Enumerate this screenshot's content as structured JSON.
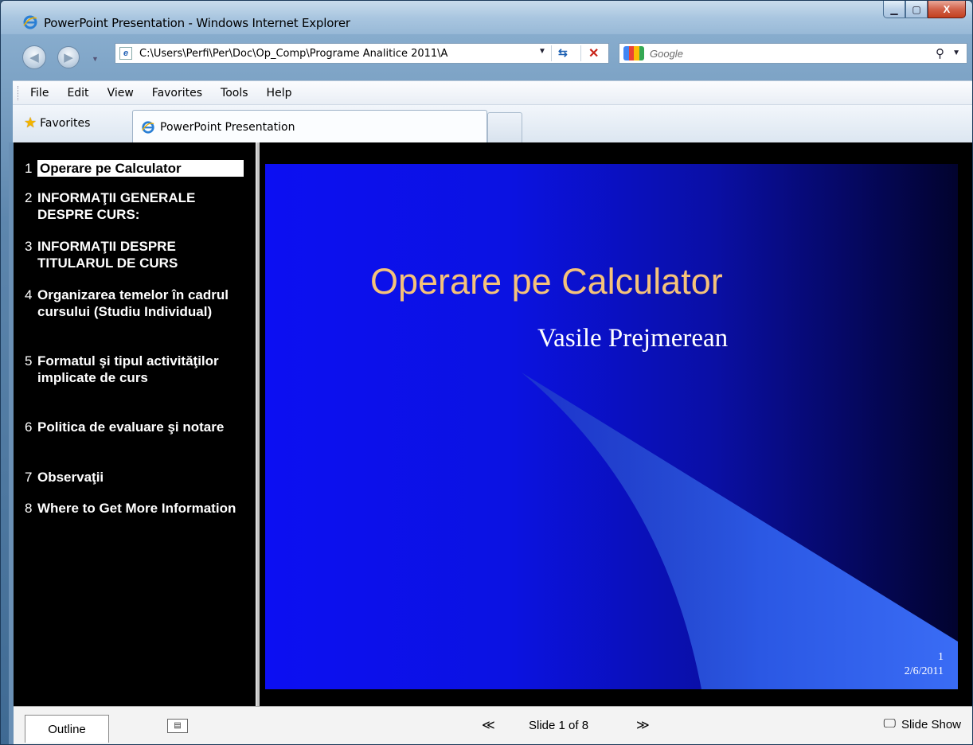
{
  "window": {
    "title": "PowerPoint Presentation - Windows Internet Explorer",
    "caption_minimize": "▁",
    "caption_maximize": "▢",
    "caption_close": "X"
  },
  "nav": {
    "back_icon": "◀",
    "forward_icon": "▶",
    "address": "C:\\Users\\Perfi\\Per\\Doc\\Op_Comp\\Programe Analitice 2011\\A",
    "search_placeholder": "Google",
    "refresh_icon": "⇆",
    "stop_icon": "✕",
    "search_icon": "⚲",
    "dropdown_icon": "▼"
  },
  "menu": [
    "File",
    "Edit",
    "View",
    "Favorites",
    "Tools",
    "Help"
  ],
  "tabs": {
    "favorites_label": "Favorites",
    "active_tab": "PowerPoint Presentation"
  },
  "outline": {
    "items": [
      {
        "num": "1",
        "text": "Operare pe Calculator",
        "selected": true
      },
      {
        "num": "2",
        "text": "INFORMAŢII GENERALE DESPRE CURS:"
      },
      {
        "num": "3",
        "text": "INFORMAŢII DESPRE TITULARUL DE CURS"
      },
      {
        "num": "4",
        "text": "Organizarea temelor în cadrul cursului  (Studiu Individual)"
      },
      {
        "num": "5",
        "text": "Formatul şi tipul activităţilor implicate de curs"
      },
      {
        "num": "6",
        "text": "Politica de evaluare şi notare"
      },
      {
        "num": "7",
        "text": "Observaţii"
      },
      {
        "num": "8",
        "text": "Where to Get More Information"
      }
    ]
  },
  "slide": {
    "title": "Operare pe Calculator",
    "subtitle": "Vasile Prejmerean",
    "number": "1",
    "date": "2/6/2011"
  },
  "bottombar": {
    "outline_tab": "Outline",
    "prev_icon": "≪",
    "counter": "Slide 1 of 8",
    "next_icon": "≫",
    "slideshow_label": "Slide Show",
    "slideshow_icon": "🖵",
    "expand_icon": "▤"
  }
}
